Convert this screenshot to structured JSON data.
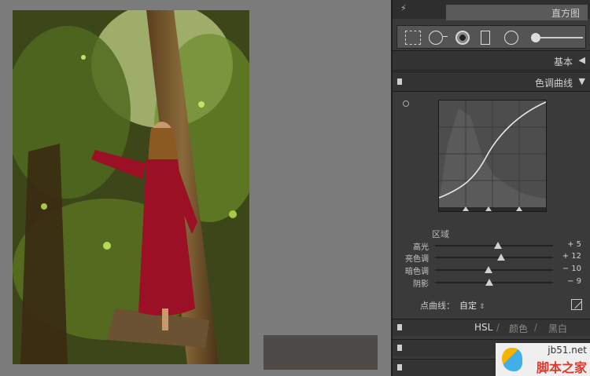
{
  "panel": {
    "top_title": "直方图",
    "basic_label": "基本",
    "tone_curve_label": "色调曲线",
    "region_label": "区域",
    "sliders": [
      {
        "name": "高光",
        "value": "+ 5",
        "position": 0.53
      },
      {
        "name": "亮色调",
        "value": "+ 12",
        "position": 0.56
      },
      {
        "name": "暗色调",
        "value": "− 10",
        "position": 0.45
      },
      {
        "name": "阴影",
        "value": "− 9",
        "position": 0.46
      }
    ],
    "point_curve_label": "点曲线：",
    "point_curve_value": "自定",
    "tabs": {
      "hsl": "HSL",
      "color": "颜色",
      "bw": "黑白"
    }
  },
  "icons": {
    "bolt": "⚡",
    "arrow_left": "◀",
    "arrow_down": "▼",
    "updown": "⇕"
  },
  "watermark": {
    "site": "jb51.net",
    "cn": "脚本之家"
  }
}
